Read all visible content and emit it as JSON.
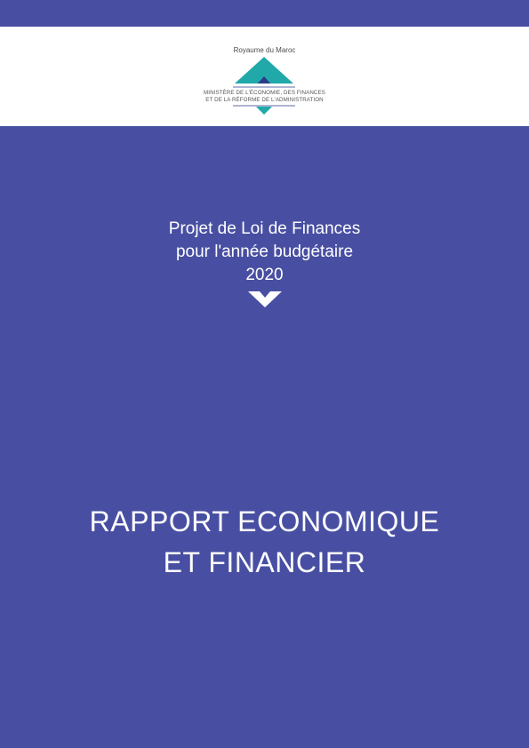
{
  "header": {
    "country": "Royaume du Maroc",
    "ministry_line1": "MINISTÈRE DE L'ÉCONOMIE, DES FINANCES",
    "ministry_line2": "ET DE LA RÉFORME DE L'ADMINISTRATION",
    "emblem_icon": "ministry-logo-icon"
  },
  "cover": {
    "subtitle_line1": "Projet de Loi de Finances",
    "subtitle_line2": "pour l'année budgétaire",
    "subtitle_line3": "2020",
    "title_line1": "RAPPORT ECONOMIQUE",
    "title_line2": "ET FINANCIER",
    "chevron_icon": "chevron-down-icon"
  },
  "colors": {
    "background": "#484fa2",
    "header_background": "#ffffff",
    "logo_teal": "#21a9a9",
    "logo_navy": "#2c3a8a",
    "text": "#ffffff"
  }
}
